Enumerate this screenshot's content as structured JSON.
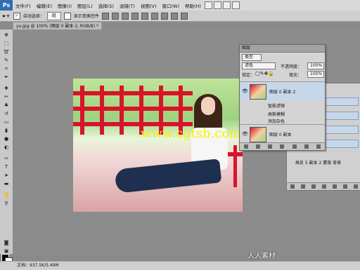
{
  "app": {
    "logo": "Ps"
  },
  "menu": [
    "文件(F)",
    "编辑(E)",
    "图像(I)",
    "图层(L)",
    "选择(S)",
    "滤镜(T)",
    "视图(V)",
    "窗口(W)",
    "帮助(H)"
  ],
  "options_bar": {
    "auto_select_label": "自动选择：",
    "auto_select_value": "组",
    "show_transform_label": "显示变换控件"
  },
  "document_tab": {
    "title": "yu.jpg @ 100% (图层 0 副本 2, RGB/8) *"
  },
  "watermark": "www.cgtsb.com",
  "layers_panel": {
    "title": "图层",
    "filter_kind": "类型",
    "blend_mode": "滤色",
    "opacity_label": "不透明度：",
    "opacity_value": "100%",
    "lock_label": "锁定：",
    "fill_label": "填充：",
    "fill_value": "100%",
    "layers": [
      {
        "name": "图层 0 副本 2"
      },
      {
        "name": "图层 0 副本"
      }
    ],
    "effects": [
      "智能滤镜",
      "高斯模糊",
      "添加杂色"
    ]
  },
  "second_panel": {
    "label": "高反 5 副本 2 蒙版 背景"
  },
  "status_bar": {
    "doc_size": "文档：937.5K/5.49M"
  },
  "bottom_logo": "人人素材",
  "colors": {
    "accent": "#2f6fb0",
    "selected_layer": "#c6d7ea",
    "watermark": "#f2f200"
  }
}
